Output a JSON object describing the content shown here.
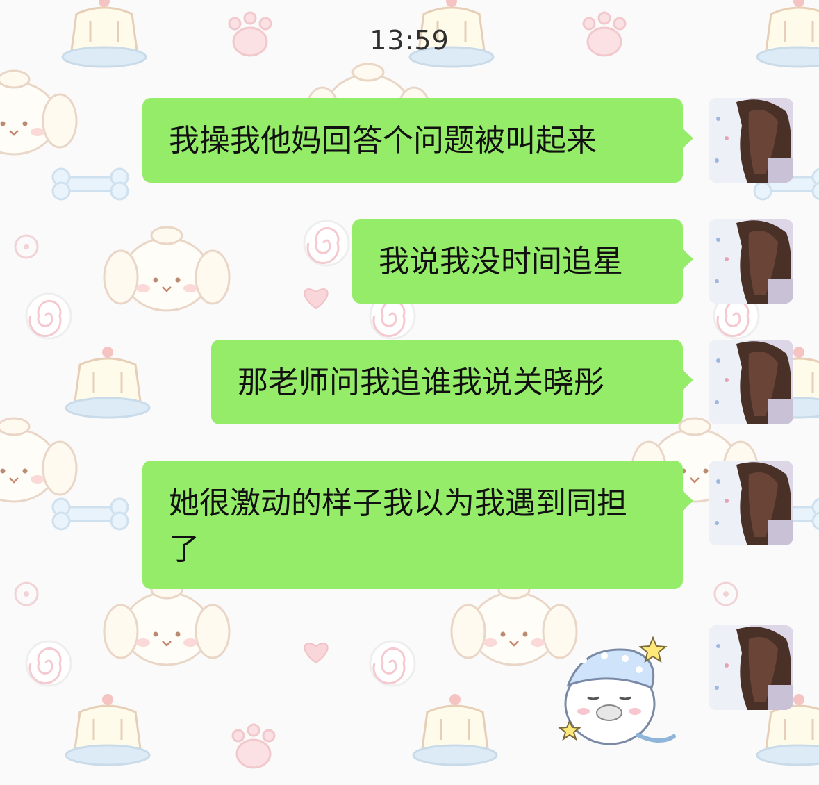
{
  "chat": {
    "timestamp": "13:59",
    "messages": [
      {
        "text": "我操我他妈回答个问题被叫起来"
      },
      {
        "text": "我说我没时间追星"
      },
      {
        "text": "那老师问我追谁我说关晓彤"
      },
      {
        "text": "她很激动的样子我以为我遇到同担了"
      }
    ]
  },
  "colors": {
    "bubble": "#95ec69",
    "background": "#fbfafa"
  }
}
